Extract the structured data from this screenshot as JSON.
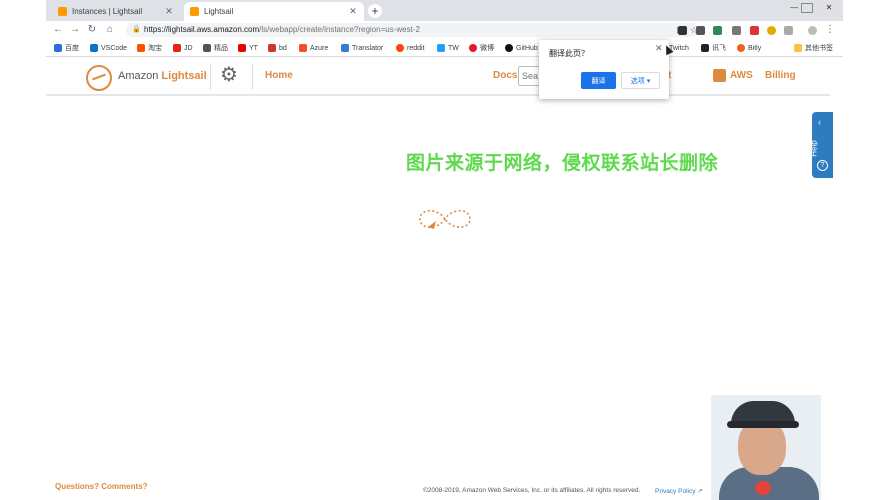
{
  "browser": {
    "tabs": [
      {
        "title": "Instances | Lightsail",
        "active": false
      },
      {
        "title": "Lightsail",
        "active": true
      }
    ],
    "new_tab_glyph": "+",
    "url_host": "https://lightsail.aws.amazon.com",
    "url_path": "/ls/webapp/create/instance?region=us-west-2",
    "bookmarks": [
      "百度",
      "VSCode",
      "淘宝",
      "JD",
      "精品",
      "YT",
      "bd",
      "Azure",
      "Translator",
      "reddit",
      "TW",
      "微博",
      "GitHub",
      "Twitch",
      "讯飞",
      "Bitly",
      "其他书签"
    ]
  },
  "translate_popup": {
    "title": "翻译此页？",
    "translate_label": "翻译",
    "options_label": "选项 ▾"
  },
  "lightsail": {
    "brand_prefix": "Amazon ",
    "brand_strong": "Lightsail",
    "home_label": "Home",
    "docs_label": "Docs",
    "search_placeholder": "Sea",
    "account_label": "t",
    "aws_label": "AWS",
    "billing_label": "Billing"
  },
  "help_tab": {
    "label": "Help",
    "chevron": "‹",
    "question": "?"
  },
  "watermark": "图片来源于网络，侵权联系站长删除",
  "footer": {
    "questions_label": "Questions? Comments?",
    "copyright": "©2008-2019, Amazon Web Services, Inc. or its affiliates. All rights reserved.",
    "privacy_label": "Privacy Policy ↗"
  },
  "colors": {
    "brand_orange": "#dd8a3e",
    "help_blue": "#2e7bbf",
    "watermark_green": "#5fd94e",
    "translate_blue": "#1a73e8"
  },
  "icons": {
    "back": "arrow-left-icon",
    "forward": "arrow-right-icon",
    "reload": "reload-icon",
    "home": "home-icon",
    "gear": "gear-icon",
    "star": "star-icon",
    "loader": "infinity-loader-icon"
  }
}
